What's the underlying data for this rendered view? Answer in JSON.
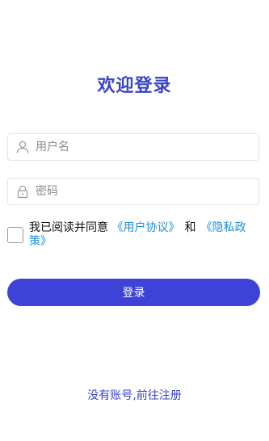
{
  "title": "欢迎登录",
  "username": {
    "placeholder": "用户名",
    "value": "",
    "icon": "user-icon"
  },
  "password": {
    "placeholder": "密码",
    "value": "",
    "icon": "lock-icon"
  },
  "agreement": {
    "checked": false,
    "prefix": "我已阅读并同意",
    "user_agreement_link": "《用户协议》",
    "conjunction": "和",
    "privacy_policy_link": "《隐私政策》"
  },
  "login_button_label": "登录",
  "register_link": "没有账号,前往注册",
  "colors": {
    "primary": "#3c43d6",
    "title": "#3a44c8",
    "link": "#1a8ee0",
    "border": "#e3e3e3"
  }
}
